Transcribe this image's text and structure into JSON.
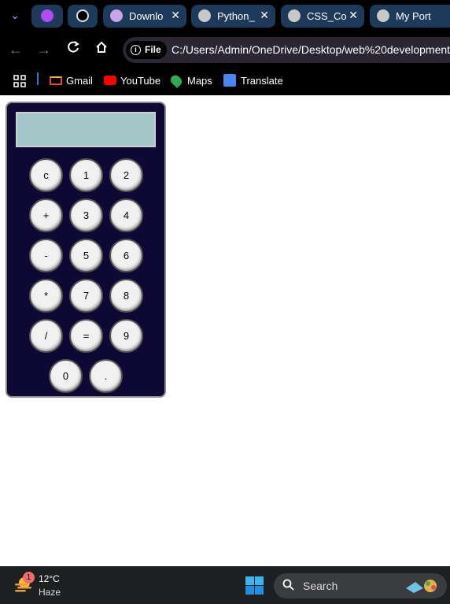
{
  "browser": {
    "tabs": [
      {
        "label": "",
        "icon": "picsart-icon"
      },
      {
        "label": "",
        "icon": "chatgpt-icon"
      },
      {
        "label": "Downlo",
        "icon": "avatar-icon",
        "close": "✕"
      },
      {
        "label": "Python_",
        "icon": "globe-icon",
        "close": "✕"
      },
      {
        "label": "CSS_Co",
        "icon": "globe-icon",
        "close": "✕"
      },
      {
        "label": "My Port",
        "icon": "globe-icon",
        "close": "✕"
      }
    ],
    "tab_menu": "⌄",
    "omnibox": {
      "scheme_label": "File",
      "url": "C:/Users/Admin/OneDrive/Desktop/web%20development"
    },
    "bookmarks": [
      {
        "label": "Gmail",
        "icon": "gmail-icon"
      },
      {
        "label": "YouTube",
        "icon": "youtube-icon"
      },
      {
        "label": "Maps",
        "icon": "maps-icon"
      },
      {
        "label": "Translate",
        "icon": "translate-icon"
      }
    ]
  },
  "calculator": {
    "display_value": "",
    "keys": {
      "c": "c",
      "k1": "1",
      "k2": "2",
      "plus": "+",
      "k3": "3",
      "k4": "4",
      "minus": "-",
      "k5": "5",
      "k6": "6",
      "mult": "*",
      "k7": "7",
      "k8": "8",
      "div": "/",
      "eq": "=",
      "k9": "9",
      "k0": "0",
      "dot": "."
    }
  },
  "taskbar": {
    "weather": {
      "badge": "1",
      "temp": "12°C",
      "condition": "Haze"
    },
    "search": {
      "label": "Search"
    }
  },
  "colors": {
    "calculator_body": "#0e0834",
    "display": "#a3c6c8",
    "key": "#f1f1f1",
    "tab_bg": "#1e3a5a"
  }
}
